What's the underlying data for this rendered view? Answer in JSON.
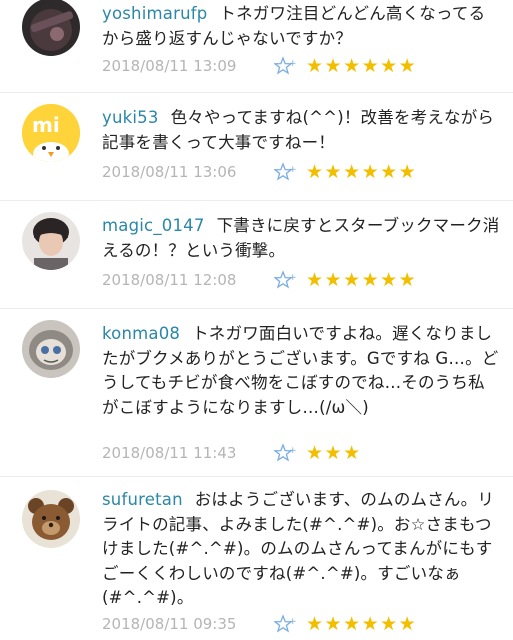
{
  "comments": [
    {
      "username": "yoshimarufp",
      "text": "トネガワ注目どんどん高くなってるから盛り返すんじゃないですか？",
      "date": "2018/08/11 13:09",
      "star_count": 6,
      "stars": "★★★★★★"
    },
    {
      "username": "yuki53",
      "text": "色々やってますね(^^)！改善を考えながら記事を書くって大事ですねー！",
      "date": "2018/08/11 13:06",
      "star_count": 6,
      "stars": "★★★★★★"
    },
    {
      "username": "magic_0147",
      "text": "下書きに戻すとスターブックマーク消えるの！？という衝撃。",
      "date": "2018/08/11 12:08",
      "star_count": 6,
      "stars": "★★★★★★"
    },
    {
      "username": "konma08",
      "text": "トネガワ面白いですよね。遅くなりましたがブクメありがとうございます。Gですね G…。どうしてもチビが食べ物をこぼすのでね…そのうち私がこぼすようになりますし…(/ω＼)",
      "date": "2018/08/11 11:43",
      "star_count": 3,
      "stars": "★★★"
    },
    {
      "username": "sufuretan",
      "text": "おはようございます、のムのムさん。リライトの記事、よみました(#^.^#)。お☆さまもつけました(#^.^#)。のムのムさんってまんがにもすごーくくわしいのですね(#^.^#)。すごいなぁ(#^.^#)。",
      "date": "2018/08/11 09:35",
      "star_count": 6,
      "stars": "★★★★★★"
    }
  ],
  "colors": {
    "username": "#2a87a8",
    "star": "#f2bf00",
    "date": "#b5b5b5",
    "add_star": "#7aaee0"
  }
}
